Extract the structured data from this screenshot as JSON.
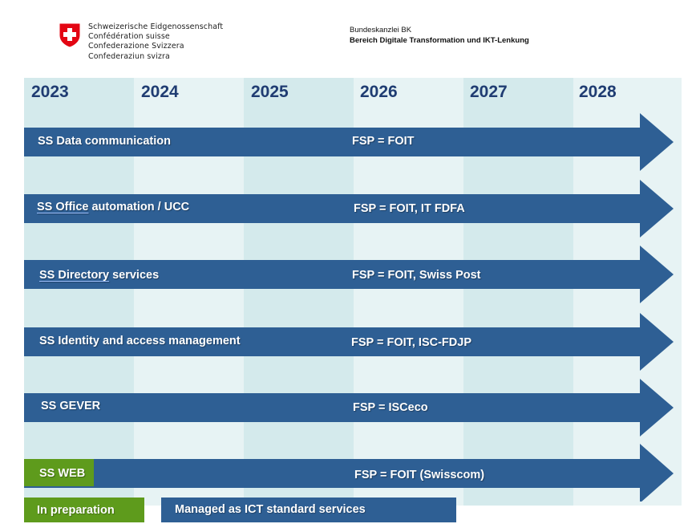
{
  "header": {
    "gov_lines": [
      "Schweizerische Eidgenossenschaft",
      "Confédération suisse",
      "Confederazione Svizzera",
      "Confederaziun svizra"
    ],
    "dept_name": "Bundeskanzlei BK",
    "dept_unit": "Bereich Digitale Transformation und IKT-Lenkung"
  },
  "years": [
    "2023",
    "2024",
    "2025",
    "2026",
    "2027",
    "2028"
  ],
  "services": [
    {
      "name_a": "",
      "name_b": "SS Data communication",
      "provider": "FSP = FOIT"
    },
    {
      "name_a": "SS Office",
      "name_b": " automation / UCC",
      "provider": "FSP = FOIT, IT FDFA"
    },
    {
      "name_a": "SS Directory",
      "name_b": " services",
      "provider": "FSP = FOIT, Swiss Post"
    },
    {
      "name_a": "",
      "name_b": "SS Identity and access management",
      "provider": "FSP = FOIT,  ISC-FDJP"
    },
    {
      "name_a": "",
      "name_b": "SS GEVER",
      "provider": "FSP = ISCeco"
    },
    {
      "name_a": "",
      "name_b": "SS WEB",
      "provider": "FSP = FOIT (Swisscom)"
    }
  ],
  "legend": {
    "in_preparation": "In preparation",
    "managed": "Managed as ICT standard services"
  },
  "colors": {
    "arrow_blue": "#2e5f94",
    "green": "#5e9b1c",
    "year_text": "#1f3c72",
    "col_dark": "#d4eaec",
    "col_light": "#e7f3f4",
    "swiss_red": "#e30613"
  }
}
